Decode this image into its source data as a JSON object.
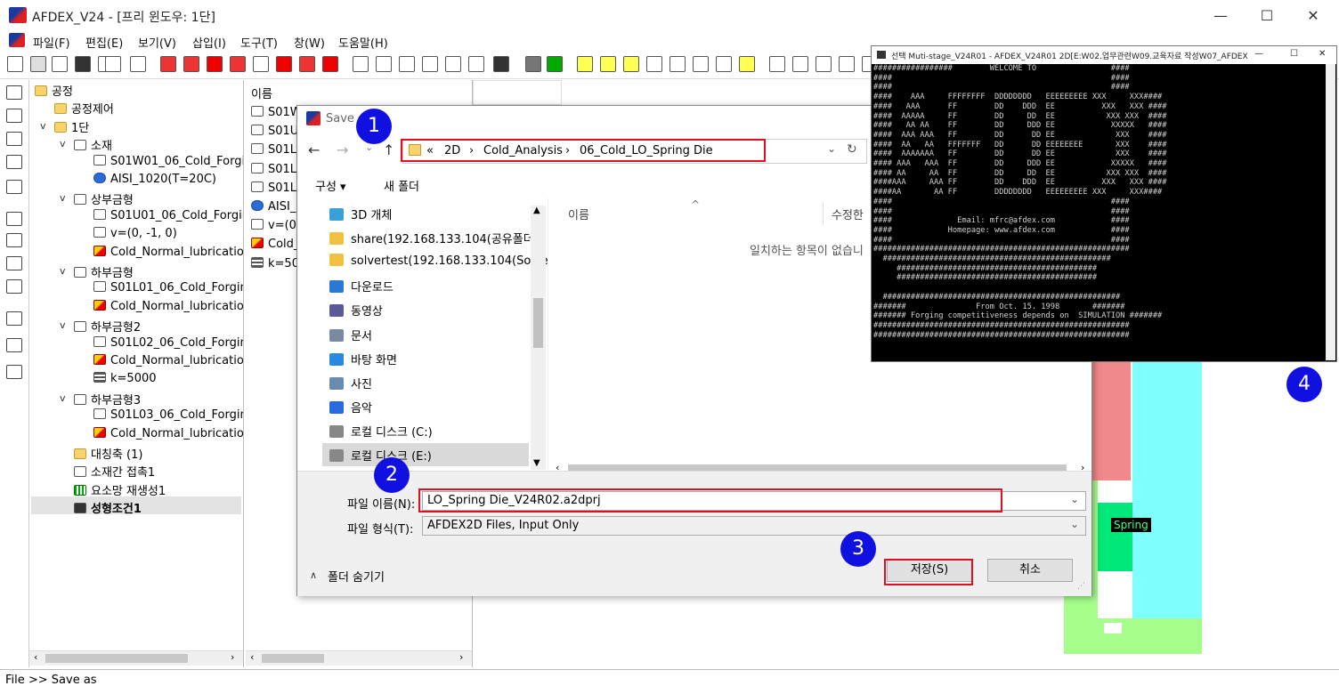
{
  "app": {
    "title": "AFDEX_V24 - [프리 윈도우: 1단]",
    "menu": [
      "파일(F)",
      "편집(E)",
      "보기(V)",
      "삽입(I)",
      "도구(T)",
      "창(W)",
      "도움말(H)"
    ],
    "window_controls": {
      "minimize": "—",
      "maximize": "☐",
      "close": "✕"
    }
  },
  "tree": {
    "items": [
      {
        "label": "공정",
        "icon": "folder-icon",
        "indent": 0,
        "arrow": ""
      },
      {
        "label": "공정제어",
        "icon": "folder-icon",
        "indent": 1,
        "arrow": ""
      },
      {
        "label": "1단",
        "icon": "folder-icon",
        "indent": 1,
        "arrow": "v"
      },
      {
        "label": "소재",
        "icon": "cube-icon",
        "indent": 2,
        "arrow": "v"
      },
      {
        "label": "S01W01_06_Cold_Forgi",
        "icon": "cube-icon",
        "indent": 3,
        "arrow": ""
      },
      {
        "label": "AISI_1020(T=20C)",
        "icon": "material-icon",
        "indent": 3,
        "arrow": ""
      },
      {
        "label": "상부금형",
        "icon": "die-icon",
        "indent": 2,
        "arrow": "v"
      },
      {
        "label": "S01U01_06_Cold_Forgir",
        "icon": "die-icon",
        "indent": 3,
        "arrow": ""
      },
      {
        "label": "v=(0, -1, 0)",
        "icon": "velocity-icon",
        "indent": 3,
        "arrow": ""
      },
      {
        "label": "Cold_Normal_lubricatior",
        "icon": "lubrication-icon",
        "indent": 3,
        "arrow": ""
      },
      {
        "label": "하부금형",
        "icon": "die-icon",
        "indent": 2,
        "arrow": "v"
      },
      {
        "label": "S01L01_06_Cold_Forgin",
        "icon": "die-icon",
        "indent": 3,
        "arrow": ""
      },
      {
        "label": "Cold_Normal_lubricatior",
        "icon": "lubrication-icon",
        "indent": 3,
        "arrow": ""
      },
      {
        "label": "하부금형2",
        "icon": "die-icon",
        "indent": 2,
        "arrow": "v"
      },
      {
        "label": "S01L02_06_Cold_Forgin",
        "icon": "die-icon",
        "indent": 3,
        "arrow": ""
      },
      {
        "label": "Cold_Normal_lubricatior",
        "icon": "lubrication-icon",
        "indent": 3,
        "arrow": ""
      },
      {
        "label": "k=5000",
        "icon": "spring-icon",
        "indent": 3,
        "arrow": ""
      },
      {
        "label": "하부금형3",
        "icon": "die-icon",
        "indent": 2,
        "arrow": "v"
      },
      {
        "label": "S01L03_06_Cold_Forgin",
        "icon": "die-icon",
        "indent": 3,
        "arrow": ""
      },
      {
        "label": "Cold_Normal_lubricatior",
        "icon": "lubrication-icon",
        "indent": 3,
        "arrow": ""
      },
      {
        "label": "대칭축 (1)",
        "icon": "axis-icon",
        "indent": 2,
        "arrow": ""
      },
      {
        "label": "소재간 접촉1",
        "icon": "contact-icon",
        "indent": 2,
        "arrow": ""
      },
      {
        "label": "요소망 재생성1",
        "icon": "mesh-icon",
        "indent": 2,
        "arrow": ""
      },
      {
        "label": "성형조건1",
        "icon": "condition-icon",
        "indent": 2,
        "arrow": "",
        "selected": true
      }
    ]
  },
  "list2": {
    "header": "이름",
    "items": [
      {
        "label": "S01W",
        "icon": "cube-icon"
      },
      {
        "label": "S01U",
        "icon": "cube-icon"
      },
      {
        "label": "S01L",
        "icon": "cube-icon"
      },
      {
        "label": "S01L",
        "icon": "cube-icon"
      },
      {
        "label": "S01L",
        "icon": "cube-icon"
      },
      {
        "label": "AISI_",
        "icon": "material-icon"
      },
      {
        "label": "v=(0,",
        "icon": "velocity-icon"
      },
      {
        "label": "Cold_",
        "icon": "lubrication-icon"
      },
      {
        "label": "k=50",
        "icon": "spring-icon"
      }
    ]
  },
  "canvas": {
    "spring_label": "Spring"
  },
  "status": {
    "text": "File >> Save as"
  },
  "dialog": {
    "title": "Save ",
    "breadcrumb": [
      "«",
      "2D",
      "›",
      "Cold_Analysis",
      "›",
      "06_Cold_LO_Spring Die"
    ],
    "organize": "구성 ▾",
    "new_folder": "새 폴더",
    "nav_items": [
      {
        "label": "3D 개체",
        "color": "#3aa0d8"
      },
      {
        "label": "share(192.168.133.104(공유폴더)",
        "color": "#f0c040"
      },
      {
        "label": "solvertest(192.168.133.104(Solve",
        "color": "#f0c040"
      },
      {
        "label": "다운로드",
        "color": "#2b78d6"
      },
      {
        "label": "동영상",
        "color": "#5a5a9a"
      },
      {
        "label": "문서",
        "color": "#7a8aa0"
      },
      {
        "label": "바탕 화면",
        "color": "#2a8ae0"
      },
      {
        "label": "사진",
        "color": "#6a8ab0"
      },
      {
        "label": "음악",
        "color": "#2a6ae0"
      },
      {
        "label": "로컬 디스크 (C:)",
        "color": "#888888"
      },
      {
        "label": "로컬 디스크 (E:)",
        "color": "#888888",
        "selected": true
      },
      {
        "label": "로컬 디스크 (F:)",
        "color": "#888888"
      }
    ],
    "col_name": "이름",
    "col_modified": "수정한",
    "empty_message": "일치하는 항목이 없습니",
    "filename_label": "파일 이름(N):",
    "filename_value": "LO_Spring Die_V24R02.a2dprj",
    "filetype_label": "파일 형식(T):",
    "filetype_value": "AFDEX2D Files, Input Only",
    "hide_folders": "폴더 숨기기",
    "save": "저장(S)",
    "cancel": "취소"
  },
  "console": {
    "title": "선택 Muti-stage_V24R01 - AFDEX_V24R01 2D[E:W02.업무관련W09.교육자료 작성W07_AFDEX_냉간교육자...",
    "controls": {
      "minimize": "—",
      "maximize": "☐",
      "close": "✕"
    },
    "text": "#################        WELCOME TO                ####\n####                                               ####\n####                                               ####\n####    AAA     FFFFFFFF  DDDDDDDD   EEEEEEEEE XXX     XXX####\n####   AAA      FF        DD    DDD  EE          XXX   XXX ####\n####  AAAAA     FF        DD     DD  EE           XXX XXX  ####\n####   AA AA    FF        DD     DDD EE            XXXXX   ####\n####  AAA AAA   FF        DD      DD EE             XXX    ####\n####  AA   AA   FFFFFFF   DD      DD EEEEEEEE       XXX    ####\n####  AAAAAAA   FF        DD      DD EE             XXX    ####\n#### AAA   AAA  FF        DD     DDD EE            XXXXX   ####\n#### AA     AA  FF        DD     DD  EE           XXX XXX  ####\n####AAA     AAA FF        DD    DDD  EE          XXX   XXX ####\n####AA       AA FF        DDDDDDDD   EEEEEEEEE XXX     XXX####\n####                                               ####\n####                                               ####\n####              Email: mfrc@afdex.com            ####\n####            Homepage: www.afdex.com            ####\n####                                               ####\n#######################################################\n  #################################################\n     ###########################################\n     ###########################################\n\n  ###################################################\n#######               From Oct. 15. 1998       #######\n####### Forging competitiveness depends on  SIMULATION #######\n#######################################################\n#######################################################"
  },
  "badges": [
    "1",
    "2",
    "3",
    "4"
  ],
  "colors": {
    "highlight": "#e01020",
    "badge": "#1010e0"
  }
}
